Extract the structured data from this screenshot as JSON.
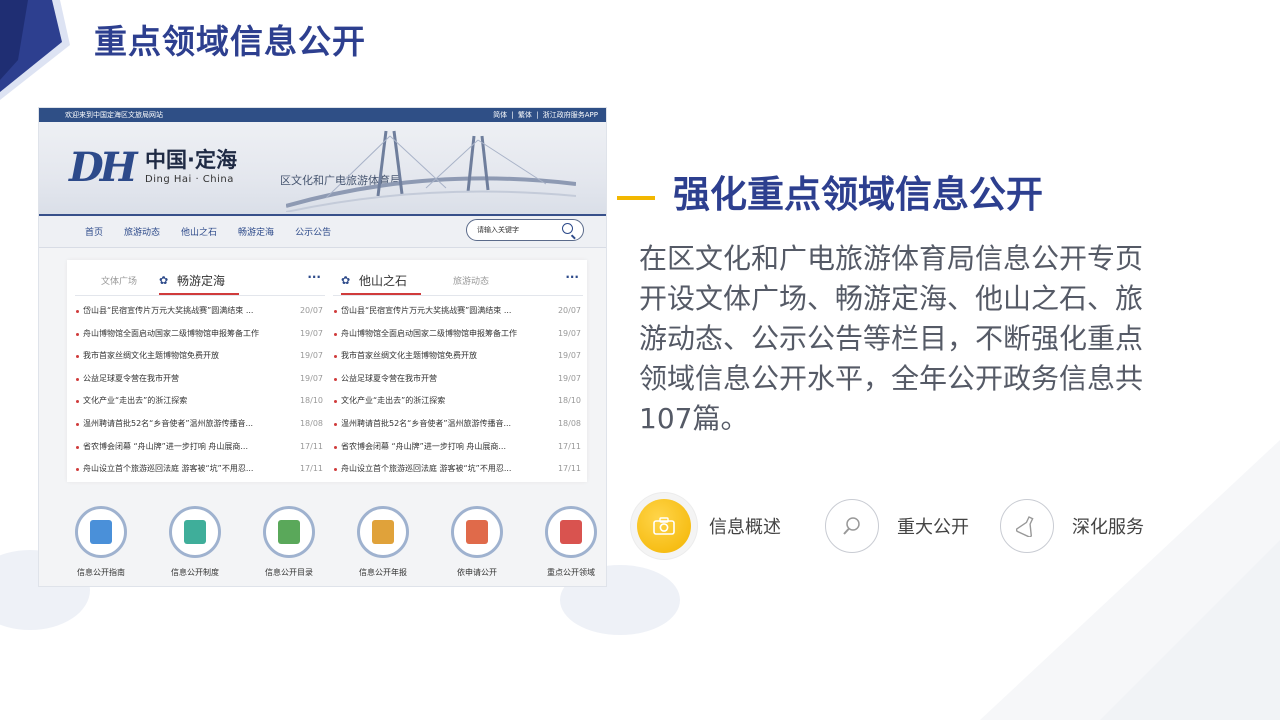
{
  "slide": {
    "title": "重点领域信息公开",
    "heading": "强化重点领域信息公开",
    "body": "在区文化和广电旅游体育局信息公开专页开设文体广场、畅游定海、他山之石、旅游动态、公示公告等栏目，不断强化重点领域信息公开水平，全年公开政务信息共107篇。",
    "accent_color": "#2d3f8f",
    "highlight_color": "#f2b700",
    "features": [
      {
        "label": "信息概述",
        "icon": "camera-icon",
        "active": true
      },
      {
        "label": "重大公开",
        "icon": "search-icon",
        "active": false
      },
      {
        "label": "深化服务",
        "icon": "flask-icon",
        "active": false
      }
    ]
  },
  "site": {
    "welcome": "欢迎来到中国定海区文旅局网站",
    "top_links": [
      "简体",
      "|",
      "繁体",
      "|",
      "浙江政府服务APP"
    ],
    "logo_mark": "DH",
    "logo_cn": "中国·定海",
    "logo_en": "Ding Hai · China",
    "logo_sub": "区文化和广电旅游体育局",
    "nav": [
      "首页",
      "旅游动态",
      "他山之石",
      "畅游定海",
      "公示公告"
    ],
    "search_placeholder": "请输入关键字",
    "left_tabs": {
      "inactive": "文体广场",
      "active": "畅游定海",
      "more": "···"
    },
    "right_tabs": {
      "active": "他山之石",
      "inactive": "旅游动态",
      "more": "···"
    },
    "news": [
      {
        "title": "岱山县“民宿宣传片万元大奖挑战赛”圆满结束 ...",
        "date": "20/07"
      },
      {
        "title": "舟山博物馆全面启动国家二级博物馆申报筹备工作",
        "date": "19/07"
      },
      {
        "title": "我市首家丝绸文化主题博物馆免费开放",
        "date": "19/07"
      },
      {
        "title": "公益足球夏令营在我市开营",
        "date": "19/07"
      },
      {
        "title": "文化产业“走出去”的浙江探索",
        "date": "18/10"
      },
      {
        "title": "温州聘请首批52名“乡音使者”温州旅游传播音...",
        "date": "18/08"
      },
      {
        "title": "省农博会闭幕 “舟山牌”进一步打响 舟山展商...",
        "date": "17/11"
      },
      {
        "title": "舟山设立首个旅游巡回法庭 游客被“坑”不用忍...",
        "date": "17/11"
      }
    ],
    "service_icons": [
      {
        "caption": "信息公开指南",
        "color": "#4a90d9"
      },
      {
        "caption": "信息公开制度",
        "color": "#3fae9a"
      },
      {
        "caption": "信息公开目录",
        "color": "#5aa85a"
      },
      {
        "caption": "信息公开年报",
        "color": "#e0a23a"
      },
      {
        "caption": "依申请公开",
        "color": "#e06a4a"
      },
      {
        "caption": "重点公开领域",
        "color": "#d9534f"
      }
    ]
  }
}
